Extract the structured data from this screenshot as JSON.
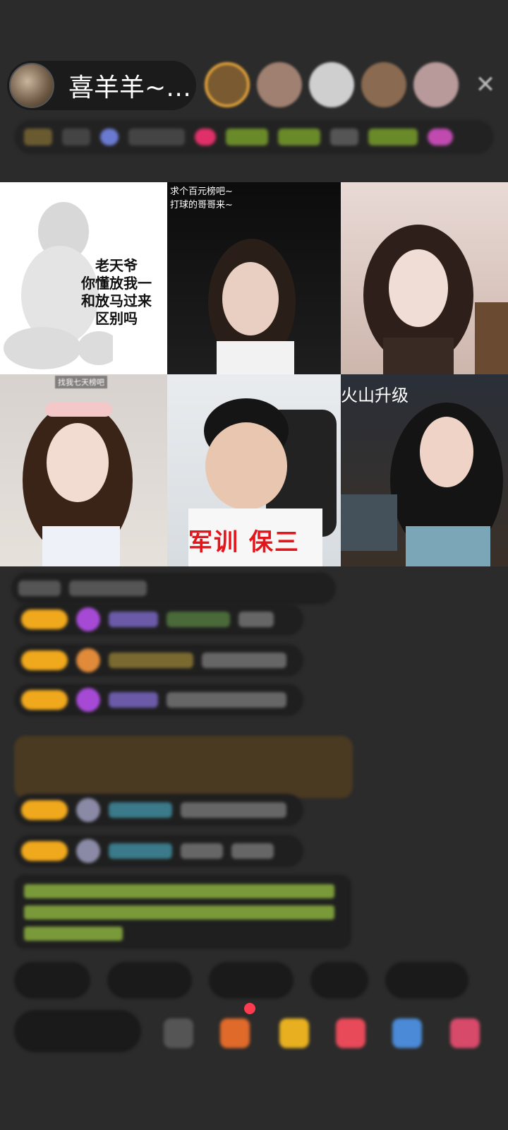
{
  "host": {
    "name": "喜羊羊~…"
  },
  "close": {
    "icon": "close-icon",
    "label": "✕"
  },
  "tiles": {
    "t1": {
      "meme_lines": [
        "老天爷",
        "你懂放我一",
        "和放马过来",
        "区别吗"
      ]
    },
    "t2": {
      "caption_lines": [
        "求个百元榜吧~",
        "打球的哥哥来~"
      ]
    },
    "t4": {
      "tag": "找我七天榜吧"
    },
    "t5": {
      "red_text": "军训 保三"
    },
    "t6": {
      "banner": "火山升级"
    }
  },
  "colors": {
    "level_badge": "#f0a81c",
    "accent_red": "#e5161b",
    "background": "#2b2b2b"
  }
}
